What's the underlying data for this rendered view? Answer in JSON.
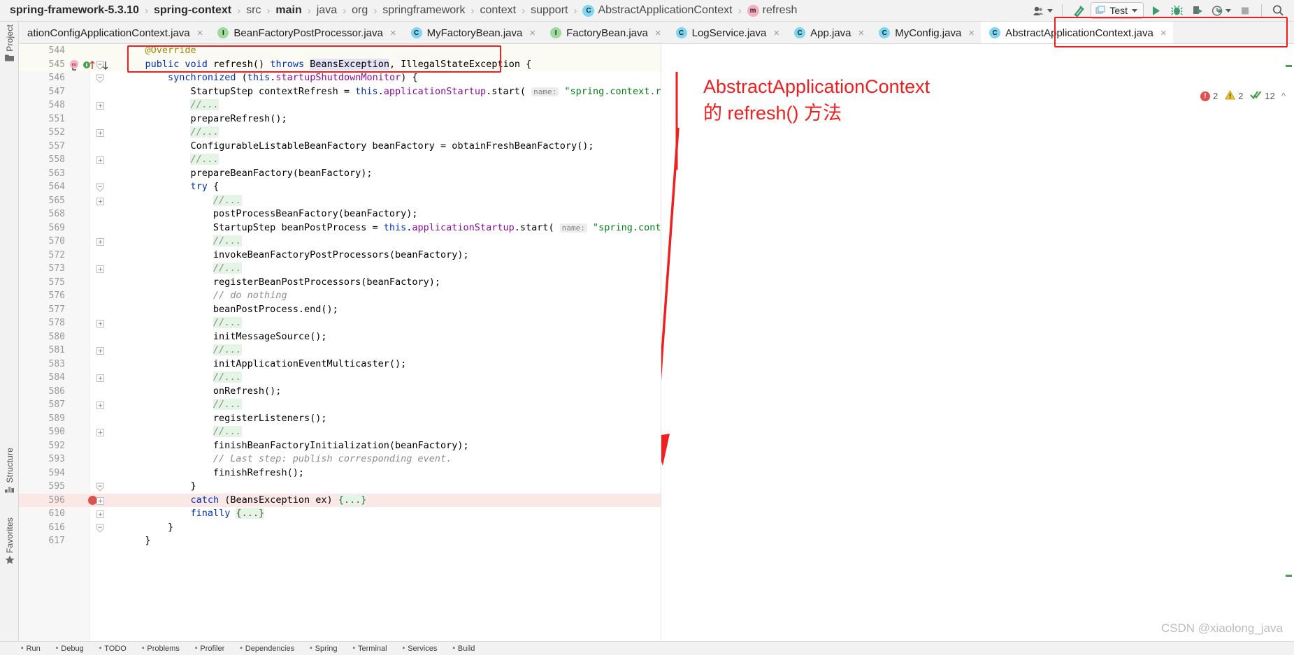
{
  "breadcrumb": {
    "items": [
      {
        "label": "spring-framework-5.3.10",
        "bold": true,
        "icon": null
      },
      {
        "label": "spring-context",
        "bold": true,
        "icon": null
      },
      {
        "label": "src",
        "bold": false,
        "icon": null
      },
      {
        "label": "main",
        "bold": true,
        "icon": null
      },
      {
        "label": "java",
        "bold": false,
        "icon": null
      },
      {
        "label": "org",
        "bold": false,
        "icon": null
      },
      {
        "label": "springframework",
        "bold": false,
        "icon": null
      },
      {
        "label": "context",
        "bold": false,
        "icon": null
      },
      {
        "label": "support",
        "bold": false,
        "icon": null
      },
      {
        "label": "AbstractApplicationContext",
        "bold": false,
        "icon": "class-icon",
        "icon_letter": "C"
      },
      {
        "label": "refresh",
        "bold": false,
        "icon": "method-icon",
        "icon_letter": "m"
      }
    ],
    "separator": "›"
  },
  "toolbar": {
    "user_icon": "user-account-icon",
    "build_icon": "build-hammer-icon",
    "run_config_label": "Test",
    "run_config_icon": "run-config-icon",
    "run_icon": "run-play-icon",
    "debug_icon": "debug-bug-icon",
    "run_coverage_icon": "run-coverage-icon",
    "profiler_icon": "profiler-clock-icon",
    "stop_icon": "stop-square-icon",
    "search_icon": "search-magnifier-icon"
  },
  "left_rail": {
    "top": [
      {
        "label": "Project",
        "icon": "project-folder-icon"
      }
    ],
    "bottom": [
      {
        "label": "Structure",
        "icon": "structure-icon"
      },
      {
        "label": "Favorites",
        "icon": "favorites-star-icon"
      }
    ]
  },
  "tabs": [
    {
      "label": "ationConfigApplicationContext.java",
      "icon": null,
      "icon_letter": "",
      "active": false,
      "truncated": true
    },
    {
      "label": "BeanFactoryPostProcessor.java",
      "icon": "interface-icon",
      "icon_letter": "I",
      "active": false
    },
    {
      "label": "MyFactoryBean.java",
      "icon": "class-icon",
      "icon_letter": "C",
      "active": false
    },
    {
      "label": "FactoryBean.java",
      "icon": "interface-icon",
      "icon_letter": "I",
      "active": false
    },
    {
      "label": "LogService.java",
      "icon": "class-icon",
      "icon_letter": "C",
      "active": false
    },
    {
      "label": "App.java",
      "icon": "class-icon",
      "icon_letter": "C",
      "active": false
    },
    {
      "label": "MyConfig.java",
      "icon": "class-icon",
      "icon_letter": "C",
      "active": false
    },
    {
      "label": "AbstractApplicationContext.java",
      "icon": "class-icon",
      "icon_letter": "C",
      "active": true
    }
  ],
  "inspections": {
    "error_count": "2",
    "warning_count": "2",
    "weak_warning_count": "12",
    "error_icon": "error-circle-icon",
    "warning_icon": "warning-triangle-icon",
    "ok_icon": "inspection-check-icon",
    "chevron": "^"
  },
  "annotation": {
    "line1": "AbstractApplicationContext",
    "line2": "的 refresh() 方法",
    "color": "#f01f1f"
  },
  "watermark": "CSDN @xiaolong_java",
  "editor": {
    "lines": [
      {
        "num": "544",
        "indent": 1,
        "fold": null,
        "tokens": [
          {
            "t": "@Override",
            "c": "ann"
          }
        ]
      },
      {
        "num": "545",
        "indent": 1,
        "fold": "open",
        "gutter_icons": true,
        "tokens": [
          {
            "t": "public ",
            "c": "kw"
          },
          {
            "t": "void ",
            "c": "kw"
          },
          {
            "t": "refresh",
            "c": "fn"
          },
          {
            "t": "() ",
            "c": ""
          },
          {
            "t": "throws ",
            "c": "kw"
          },
          {
            "t": "BeansException",
            "c": "sel"
          },
          {
            "t": ", IllegalStateException {",
            "c": ""
          }
        ]
      },
      {
        "num": "546",
        "indent": 2,
        "fold": "open",
        "tokens": [
          {
            "t": "synchronized ",
            "c": "kw"
          },
          {
            "t": "(",
            "c": ""
          },
          {
            "t": "this",
            "c": "kw"
          },
          {
            "t": ".",
            "c": ""
          },
          {
            "t": "startupShutdownMonitor",
            "c": "fld"
          },
          {
            "t": ") {",
            "c": ""
          }
        ]
      },
      {
        "num": "547",
        "indent": 3,
        "fold": null,
        "tokens": [
          {
            "t": "StartupStep contextRefresh = ",
            "c": ""
          },
          {
            "t": "this",
            "c": "kw"
          },
          {
            "t": ".",
            "c": ""
          },
          {
            "t": "applicationStartup",
            "c": "fld"
          },
          {
            "t": ".start( ",
            "c": ""
          },
          {
            "t": "name:",
            "c": "hint"
          },
          {
            "t": " ",
            "c": ""
          },
          {
            "t": "\"spring.context.refresh\"",
            "c": "str"
          },
          {
            "t": ");",
            "c": ""
          }
        ]
      },
      {
        "num": "548",
        "indent": 3,
        "fold": "closed",
        "tokens": [
          {
            "t": "//...",
            "c": "cmtdots"
          }
        ]
      },
      {
        "num": "551",
        "indent": 3,
        "fold": null,
        "tokens": [
          {
            "t": "prepareRefresh();",
            "c": ""
          }
        ]
      },
      {
        "num": "552",
        "indent": 3,
        "fold": "closed",
        "tokens": [
          {
            "t": "//...",
            "c": "cmtdots"
          }
        ]
      },
      {
        "num": "557",
        "indent": 3,
        "fold": null,
        "tokens": [
          {
            "t": "ConfigurableListableBeanFactory beanFactory = obtainFreshBeanFactory();",
            "c": ""
          }
        ]
      },
      {
        "num": "558",
        "indent": 3,
        "fold": "closed",
        "tokens": [
          {
            "t": "//...",
            "c": "cmtdots"
          }
        ]
      },
      {
        "num": "563",
        "indent": 3,
        "fold": null,
        "tokens": [
          {
            "t": "prepareBeanFactory(beanFactory);",
            "c": ""
          }
        ]
      },
      {
        "num": "564",
        "indent": 3,
        "fold": "open",
        "tokens": [
          {
            "t": "try",
            "c": "kw"
          },
          {
            "t": " {",
            "c": ""
          }
        ]
      },
      {
        "num": "565",
        "indent": 4,
        "fold": "closed",
        "tokens": [
          {
            "t": "//...",
            "c": "cmtdots"
          }
        ]
      },
      {
        "num": "568",
        "indent": 4,
        "fold": null,
        "tokens": [
          {
            "t": "postProcessBeanFactory(beanFactory);",
            "c": ""
          }
        ]
      },
      {
        "num": "569",
        "indent": 4,
        "fold": null,
        "tokens": [
          {
            "t": "StartupStep beanPostProcess = ",
            "c": ""
          },
          {
            "t": "this",
            "c": "kw"
          },
          {
            "t": ".",
            "c": ""
          },
          {
            "t": "applicationStartup",
            "c": "fld"
          },
          {
            "t": ".start( ",
            "c": ""
          },
          {
            "t": "name:",
            "c": "hint"
          },
          {
            "t": " ",
            "c": ""
          },
          {
            "t": "\"spring.context.beans.post-process\"",
            "c": "str"
          },
          {
            "t": ");",
            "c": ""
          }
        ]
      },
      {
        "num": "570",
        "indent": 4,
        "fold": "closed",
        "tokens": [
          {
            "t": "//...",
            "c": "cmtdots"
          }
        ]
      },
      {
        "num": "572",
        "indent": 4,
        "fold": null,
        "tokens": [
          {
            "t": "invokeBeanFactoryPostProcessors(beanFactory);",
            "c": ""
          }
        ]
      },
      {
        "num": "573",
        "indent": 4,
        "fold": "closed",
        "tokens": [
          {
            "t": "//...",
            "c": "cmtdots"
          }
        ]
      },
      {
        "num": "575",
        "indent": 4,
        "fold": null,
        "tokens": [
          {
            "t": "registerBeanPostProcessors(beanFactory);",
            "c": ""
          }
        ]
      },
      {
        "num": "576",
        "indent": 4,
        "fold": null,
        "tokens": [
          {
            "t": "// do nothing",
            "c": "cmt"
          }
        ]
      },
      {
        "num": "577",
        "indent": 4,
        "fold": null,
        "tokens": [
          {
            "t": "beanPostProcess.end();",
            "c": ""
          }
        ]
      },
      {
        "num": "578",
        "indent": 4,
        "fold": "closed",
        "tokens": [
          {
            "t": "//...",
            "c": "cmtdots"
          }
        ]
      },
      {
        "num": "580",
        "indent": 4,
        "fold": null,
        "tokens": [
          {
            "t": "initMessageSource();",
            "c": ""
          }
        ]
      },
      {
        "num": "581",
        "indent": 4,
        "fold": "closed",
        "tokens": [
          {
            "t": "//...",
            "c": "cmtdots"
          }
        ]
      },
      {
        "num": "583",
        "indent": 4,
        "fold": null,
        "tokens": [
          {
            "t": "initApplicationEventMulticaster();",
            "c": ""
          }
        ]
      },
      {
        "num": "584",
        "indent": 4,
        "fold": "closed",
        "tokens": [
          {
            "t": "//...",
            "c": "cmtdots"
          }
        ]
      },
      {
        "num": "586",
        "indent": 4,
        "fold": null,
        "tokens": [
          {
            "t": "onRefresh();",
            "c": ""
          }
        ]
      },
      {
        "num": "587",
        "indent": 4,
        "fold": "closed",
        "tokens": [
          {
            "t": "//...",
            "c": "cmtdots"
          }
        ]
      },
      {
        "num": "589",
        "indent": 4,
        "fold": null,
        "tokens": [
          {
            "t": "registerListeners();",
            "c": ""
          }
        ]
      },
      {
        "num": "590",
        "indent": 4,
        "fold": "closed",
        "tokens": [
          {
            "t": "//...",
            "c": "cmtdots"
          }
        ]
      },
      {
        "num": "592",
        "indent": 4,
        "fold": null,
        "tokens": [
          {
            "t": "finishBeanFactoryInitialization(beanFactory);",
            "c": ""
          }
        ]
      },
      {
        "num": "593",
        "indent": 4,
        "fold": null,
        "tokens": [
          {
            "t": "// Last step: publish corresponding event.",
            "c": "cmt"
          }
        ]
      },
      {
        "num": "594",
        "indent": 4,
        "fold": null,
        "tokens": [
          {
            "t": "finishRefresh();",
            "c": ""
          }
        ]
      },
      {
        "num": "595",
        "indent": 3,
        "fold": "open",
        "tokens": [
          {
            "t": "}",
            "c": ""
          }
        ]
      },
      {
        "num": "596",
        "indent": 3,
        "fold": "closed",
        "breakpoint": true,
        "tokens": [
          {
            "t": "catch",
            "c": "kw"
          },
          {
            "t": " (BeansException ex) ",
            "c": ""
          },
          {
            "t": "{...}",
            "c": "folded"
          }
        ]
      },
      {
        "num": "610",
        "indent": 3,
        "fold": "closed",
        "tokens": [
          {
            "t": "finally",
            "c": "kw"
          },
          {
            "t": " ",
            "c": ""
          },
          {
            "t": "{...}",
            "c": "folded"
          }
        ]
      },
      {
        "num": "616",
        "indent": 2,
        "fold": "open",
        "tokens": [
          {
            "t": "}",
            "c": ""
          }
        ]
      },
      {
        "num": "617",
        "indent": 1,
        "fold": null,
        "tokens": [
          {
            "t": "}",
            "c": ""
          }
        ]
      }
    ]
  },
  "statusbar": {
    "items": [
      {
        "label": "Run",
        "icon": "run-play-icon"
      },
      {
        "label": "Debug",
        "icon": "debug-bug-icon"
      },
      {
        "label": "TODO",
        "icon": "todo-list-icon"
      },
      {
        "label": "Problems",
        "icon": "problems-icon"
      },
      {
        "label": "Profiler",
        "icon": "profiler-icon"
      },
      {
        "label": "Dependencies",
        "icon": "dependencies-icon"
      },
      {
        "label": "Spring",
        "icon": "spring-leaf-icon"
      },
      {
        "label": "Terminal",
        "icon": "terminal-icon"
      },
      {
        "label": "Services",
        "icon": "services-icon"
      },
      {
        "label": "Build",
        "icon": "build-icon"
      }
    ]
  }
}
